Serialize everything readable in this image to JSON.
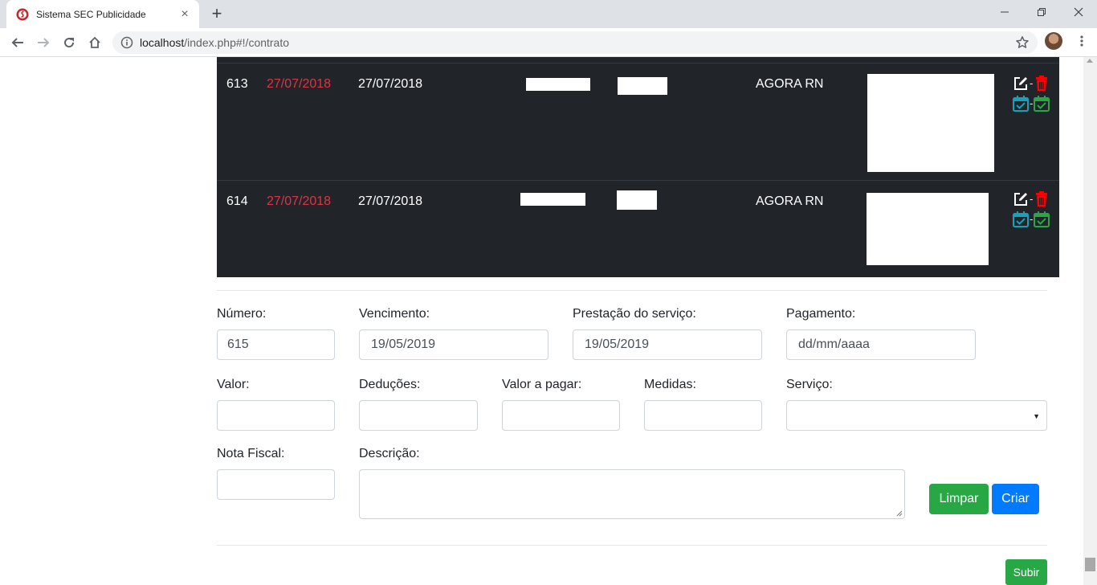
{
  "browser": {
    "tab_title": "Sistema SEC Publicidade",
    "url_host": "localhost",
    "url_path": "/index.php#!/contrato",
    "tab_close": "×",
    "new_tab": "+"
  },
  "table": {
    "rows": [
      {
        "numero": "613",
        "vencimento": "27/07/2018",
        "prestacao": "27/07/2018",
        "cliente": "AGORA RN"
      },
      {
        "numero": "614",
        "vencimento": "27/07/2018",
        "prestacao": "27/07/2018",
        "cliente": "AGORA RN"
      }
    ],
    "action_separator": "-",
    "colors": {
      "background": "#212529",
      "vencimento": "#dc3545",
      "edit": "#ffffff",
      "delete": "#ff0000",
      "calendar_blue": "#17a2b8",
      "calendar_green": "#28a745"
    }
  },
  "form": {
    "numero": {
      "label": "Número:",
      "value": "615"
    },
    "vencimento": {
      "label": "Vencimento:",
      "value": "19/05/2019"
    },
    "prestacao": {
      "label": "Prestação do serviço:",
      "value": "19/05/2019"
    },
    "pagamento": {
      "label": "Pagamento:",
      "placeholder": "dd/mm/aaaa"
    },
    "valor": {
      "label": "Valor:",
      "value": ""
    },
    "deducoes": {
      "label": "Deduções:",
      "value": ""
    },
    "valor_pagar": {
      "label": "Valor a pagar:",
      "value": ""
    },
    "medidas": {
      "label": "Medidas:",
      "value": ""
    },
    "servico": {
      "label": "Serviço:",
      "value": ""
    },
    "nota_fiscal": {
      "label": "Nota Fiscal:",
      "value": ""
    },
    "descricao": {
      "label": "Descrição:",
      "value": ""
    },
    "limpar_label": "Limpar",
    "criar_label": "Criar"
  },
  "subir_label": "Subir"
}
